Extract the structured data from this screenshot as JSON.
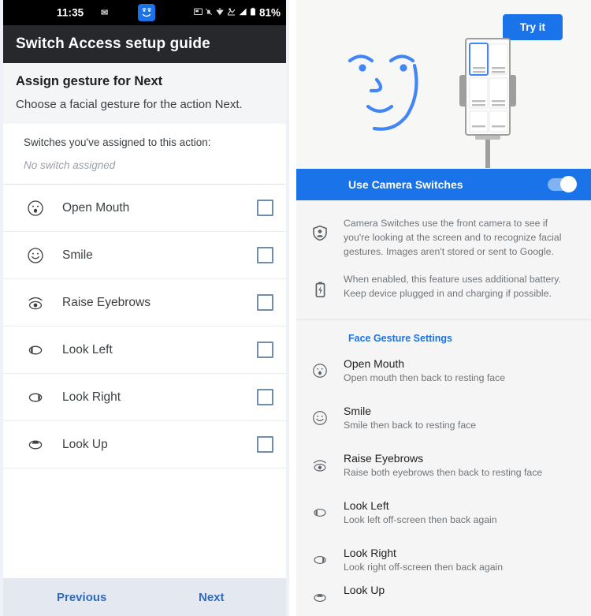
{
  "left": {
    "status_bar": {
      "time": "11:35",
      "mail_icon": "mail-icon",
      "face_icon": "camera-switches-face-icon",
      "icons": [
        "screenshot-icon",
        "notifications-off-icon",
        "wifi-icon",
        "vpn-icon",
        "signal-icon",
        "battery-icon"
      ],
      "battery_percent": "81%"
    },
    "app_bar": {
      "title": "Switch Access setup guide"
    },
    "intro": {
      "title": "Assign gesture for Next",
      "subtitle": "Choose a facial gesture for the action Next."
    },
    "assigned": {
      "label": "Switches you've assigned to this action:",
      "value": "No switch assigned"
    },
    "gestures": [
      {
        "label": "Open Mouth",
        "icon": "open-mouth-face-icon",
        "checked": false
      },
      {
        "label": "Smile",
        "icon": "smile-face-icon",
        "checked": false
      },
      {
        "label": "Raise Eyebrows",
        "icon": "raise-eyebrows-eye-icon",
        "checked": false
      },
      {
        "label": "Look Left",
        "icon": "look-left-eye-icon",
        "checked": false
      },
      {
        "label": "Look Right",
        "icon": "look-right-eye-icon",
        "checked": false
      },
      {
        "label": "Look Up",
        "icon": "look-up-eye-icon",
        "checked": false
      }
    ],
    "bottom_nav": {
      "previous": "Previous",
      "next": "Next"
    }
  },
  "right": {
    "hero": {
      "try_button": "Try it",
      "face_icon": "illustration-face-icon",
      "phone_icon": "illustration-phone-scanning-icon"
    },
    "toggle": {
      "label": "Use Camera Switches",
      "enabled": true
    },
    "info": [
      {
        "icon": "privacy-shield-icon",
        "text": "Camera Switches use the front camera to see if you're looking at the screen and to recognize facial gestures. Images aren't stored or sent to Google."
      },
      {
        "icon": "battery-charging-icon",
        "text": "When enabled, this feature uses additional battery. Keep device plugged in and charging if possible."
      }
    ],
    "section_title": "Face Gesture Settings",
    "gestures": [
      {
        "title": "Open Mouth",
        "desc": "Open mouth then back to resting face",
        "icon": "open-mouth-face-icon"
      },
      {
        "title": "Smile",
        "desc": "Smile then back to resting face",
        "icon": "smile-face-icon"
      },
      {
        "title": "Raise Eyebrows",
        "desc": "Raise both eyebrows then back to resting face",
        "icon": "raise-eyebrows-eye-icon"
      },
      {
        "title": "Look Left",
        "desc": "Look left off-screen then back again",
        "icon": "look-left-eye-icon"
      },
      {
        "title": "Look Right",
        "desc": "Look right off-screen then back again",
        "icon": "look-right-eye-icon"
      },
      {
        "title": "Look Up",
        "desc": "",
        "icon": "look-up-eye-icon"
      }
    ]
  },
  "colors": {
    "accent_blue": "#1a73e8",
    "status_bar_bg": "#000000",
    "app_bar_bg": "#26282b",
    "link_blue": "#2f6bbd"
  }
}
